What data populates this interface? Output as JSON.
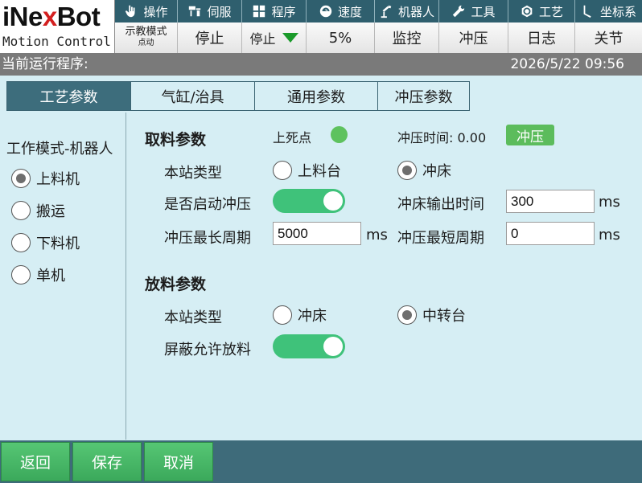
{
  "logo": {
    "brand_pre": "iNe",
    "brand_x": "x",
    "brand_post": "Bot",
    "tagline": "Motion Control"
  },
  "menu": [
    {
      "label": "操作",
      "icon": "hand-icon"
    },
    {
      "label": "伺服",
      "icon": "servo-icon"
    },
    {
      "label": "程序",
      "icon": "program-grid-icon"
    },
    {
      "label": "速度",
      "icon": "gauge-icon"
    },
    {
      "label": "机器人",
      "icon": "robot-arm-icon"
    },
    {
      "label": "工具",
      "icon": "wrench-icon"
    },
    {
      "label": "工艺",
      "icon": "process-icon"
    },
    {
      "label": "坐标系",
      "icon": "axis-icon"
    }
  ],
  "status": {
    "mode_main": "示教模式",
    "mode_sub": "点动",
    "servo_state": "停止",
    "run_state": "停止",
    "speed": "5%",
    "monitor": "监控",
    "stamping": "冲压",
    "log": "日志",
    "joint": "关节"
  },
  "program_bar": {
    "label": "当前运行程序:",
    "datetime": "2026/5/22 09:56"
  },
  "tabs": [
    "工艺参数",
    "气缸/治具",
    "通用参数",
    "冲压参数"
  ],
  "left": {
    "title": "工作模式-机器人",
    "options": [
      "上料机",
      "搬运",
      "下料机",
      "单机"
    ],
    "selected_index": 0
  },
  "pick": {
    "title": "取料参数",
    "top_dead_label": "上死点",
    "press_time_label": "冲压时间:",
    "press_time_value": "0.00",
    "press_button": "冲压",
    "station_type_label": "本站类型",
    "station_options": [
      "上料台",
      "冲床"
    ],
    "station_selected": 1,
    "enable_press_label": "是否启动冲压",
    "enable_press_on": true,
    "output_time_label": "冲床输出时间",
    "output_time_value": "300",
    "max_cycle_label": "冲压最长周期",
    "max_cycle_value": "5000",
    "min_cycle_label": "冲压最短周期",
    "min_cycle_value": "0",
    "unit": "ms"
  },
  "place": {
    "title": "放料参数",
    "station_type_label": "本站类型",
    "station_options": [
      "冲床",
      "中转台"
    ],
    "station_selected": 1,
    "shield_label": "屏蔽允许放料",
    "shield_on": true
  },
  "buttons": {
    "back": "返回",
    "save": "保存",
    "cancel": "取消"
  },
  "colors": {
    "header": "#2f5f6e",
    "accent_green": "#3fc27a",
    "tab_active": "#3d6d7c",
    "background": "#d6eef4"
  }
}
